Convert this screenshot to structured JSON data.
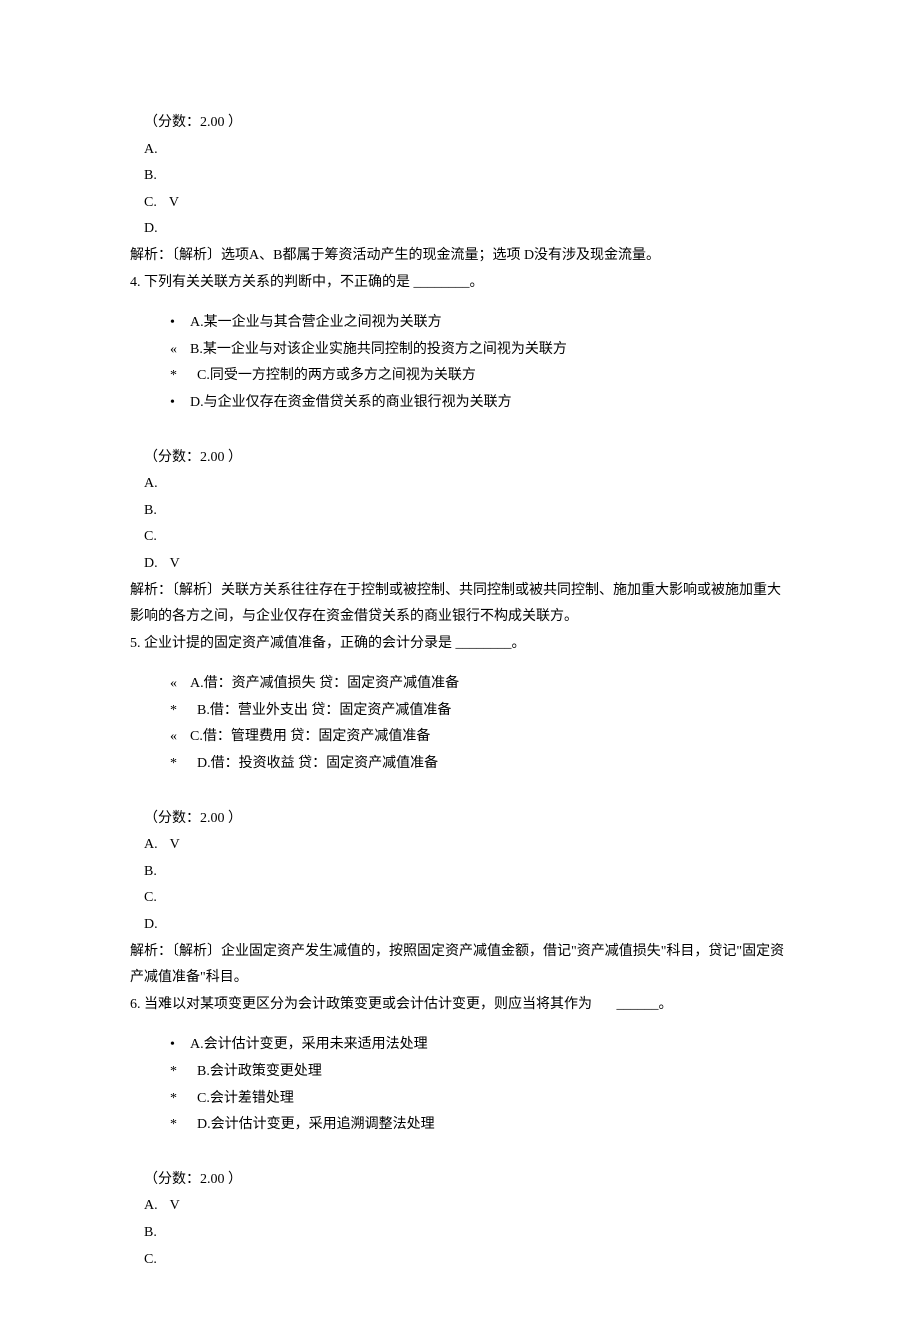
{
  "q3": {
    "score": "（分数：2.00 ）",
    "A": "A.",
    "B": "B.",
    "C": "C.",
    "C_mark": "V",
    "D": "D.",
    "analysis": "解析：〔解析〕选项A、B都属于筹资活动产生的现金流量；选项 D没有涉及现金流量。"
  },
  "q4": {
    "stem_num": "4.",
    "stem": "下列有关关联方关系的判断中，不正确的是",
    "blank": " ________。",
    "opts": {
      "A_bullet": "•",
      "A": "A.某一企业与其合营企业之间视为关联方",
      "B_bullet": "«",
      "B": "B.某一企业与对该企业实施共同控制的投资方之间视为关联方",
      "C_bullet": "*",
      "C": "C.同受一方控制的两方或多方之间视为关联方",
      "D_bullet": "•",
      "D": "D.与企业仅存在资金借贷关系的商业银行视为关联方"
    },
    "score": "（分数：2.00 ）",
    "A": "A.",
    "B": "B.",
    "C": "C.",
    "D": "D.",
    "D_mark": "V",
    "analysis": "解析：〔解析〕关联方关系往往存在于控制或被控制、共同控制或被共同控制、施加重大影响或被施加重大影响的各方之间，与企业仅存在资金借贷关系的商业银行不构成关联方。"
  },
  "q5": {
    "stem_num": "5.",
    "stem": "企业计提的固定资产减值准备，正确的会计分录是",
    "blank": " ________。",
    "opts": {
      "A_bullet": "«",
      "A": "A.借：资产减值损失  贷：固定资产减值准备",
      "B_bullet": "*",
      "B": "B.借：营业外支出  贷：固定资产减值准备",
      "C_bullet": "«",
      "C": "C.借：管理费用  贷：固定资产减值准备",
      "D_bullet": "*",
      "D": "D.借：投资收益  贷：固定资产减值准备"
    },
    "score": "（分数：2.00 ）",
    "A": "A.",
    "A_mark": "V",
    "B": "B.",
    "C": "C.",
    "D": "D.",
    "analysis": "解析：〔解析〕企业固定资产发生减值的，按照固定资产减值金额，借记\"资产减值损失\"科目，贷记\"固定资产减值准备\"科目。"
  },
  "q6": {
    "stem_num": "6.",
    "stem": "当难以对某项变更区分为会计政策变更或会计估计变更，则应当将其作为",
    "blank": " ______。",
    "opts": {
      "A_bullet": "•",
      "A": "A.会计估计变更，采用未来适用法处理",
      "B_bullet": "*",
      "B": "B.会计政策变更处理",
      "C_bullet": "*",
      "C": "C.会计差错处理",
      "D_bullet": "*",
      "D": "D.会计估计变更，采用追溯调整法处理"
    },
    "score": "（分数：2.00 ）",
    "A": "A.",
    "A_mark": "V",
    "B": "B.",
    "C": "C."
  }
}
